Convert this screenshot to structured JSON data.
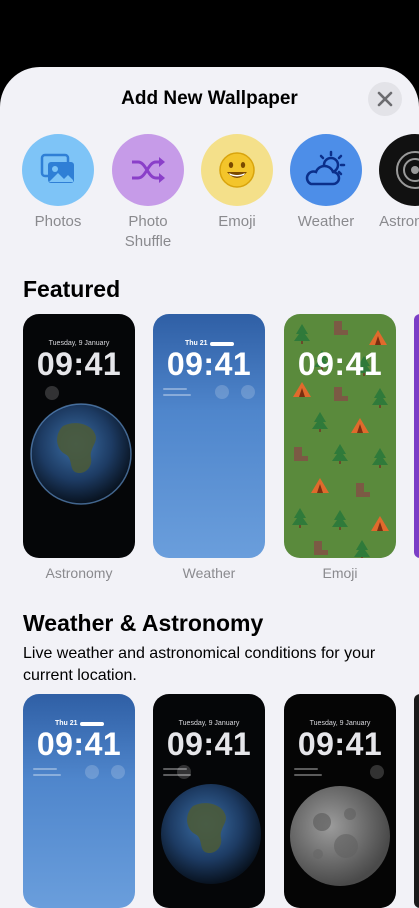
{
  "sheet": {
    "title": "Add New Wallpaper"
  },
  "categories": [
    {
      "label": "Photos",
      "icon": "photos-icon",
      "color": "#7ec4f7"
    },
    {
      "label": "Photo\nShuffle",
      "icon": "shuffle-icon",
      "color": "#c69be8"
    },
    {
      "label": "Emoji",
      "icon": "emoji-icon",
      "color": "#f4e08a"
    },
    {
      "label": "Weather",
      "icon": "weather-icon",
      "color": "#4d8ee8"
    },
    {
      "label": "Astronomy",
      "icon": "astronomy-icon",
      "color": "#111111"
    }
  ],
  "featured": {
    "heading": "Featured",
    "cards": [
      {
        "label": "Astronomy",
        "date": "Tuesday, 9 January",
        "time": "09:41"
      },
      {
        "label": "Weather",
        "date": "Thu 21",
        "time": "09:41"
      },
      {
        "label": "Emoji",
        "date": "",
        "time": "09:41"
      }
    ]
  },
  "weather_astronomy": {
    "heading": "Weather & Astronomy",
    "description": "Live weather and astronomical conditions for your current location.",
    "cards": [
      {
        "date": "Thu 21",
        "time": "09:41"
      },
      {
        "date": "Tuesday, 9 January",
        "time": "09:41"
      },
      {
        "date": "Tuesday, 9 January",
        "time": "09:41"
      }
    ]
  }
}
